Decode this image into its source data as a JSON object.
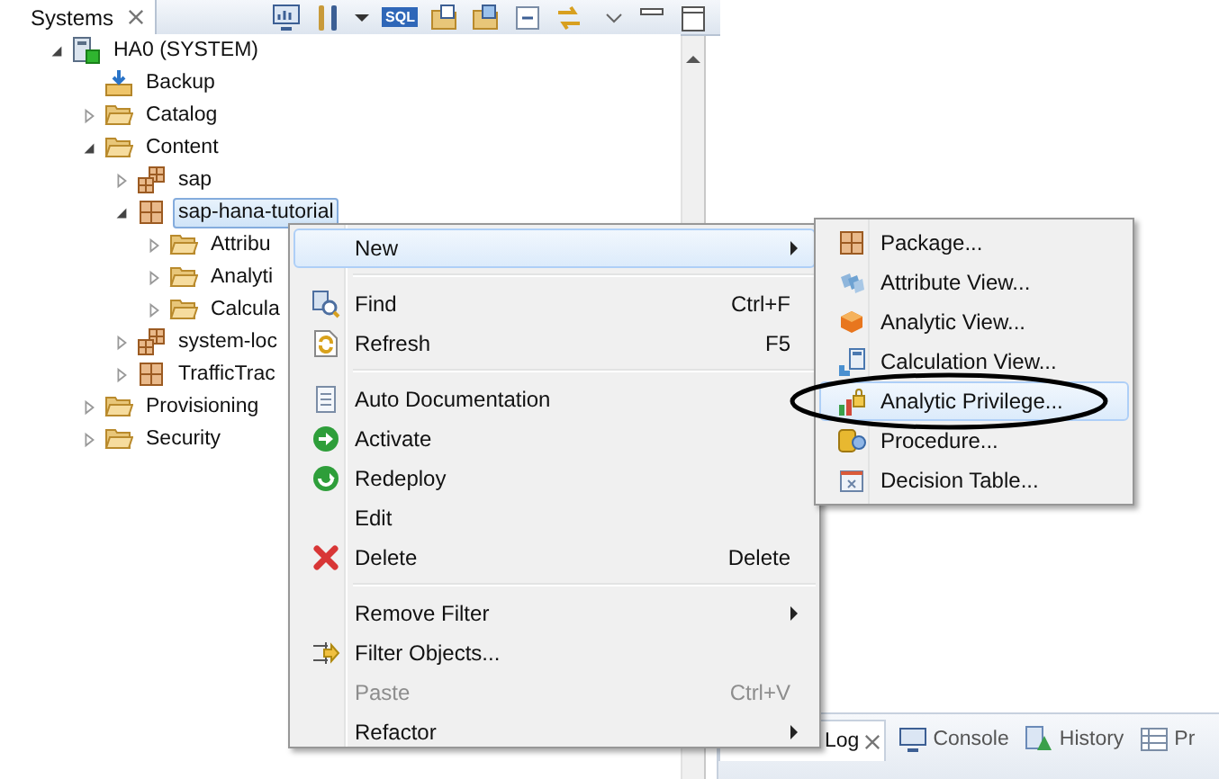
{
  "view_tab": {
    "title": "Systems",
    "selected": true
  },
  "toolbar": {
    "sql_label": "SQL"
  },
  "tree": [
    {
      "label": "HA0 (SYSTEM)",
      "kind": "system",
      "expanded": true,
      "selected": false,
      "children": [
        {
          "label": "Backup",
          "kind": "backup",
          "selected": false
        },
        {
          "label": "Catalog",
          "kind": "folder",
          "expanded": false,
          "selected": false
        },
        {
          "label": "Content",
          "kind": "folder",
          "expanded": true,
          "selected": false,
          "children": [
            {
              "label": "sap",
              "kind": "packages",
              "expanded": false,
              "selected": false
            },
            {
              "label": "sap-hana-tutorial",
              "kind": "package",
              "expanded": true,
              "selected": true,
              "children": [
                {
                  "label": "Attribu",
                  "kind": "folder",
                  "expanded": false,
                  "selected": false
                },
                {
                  "label": "Analyti",
                  "kind": "folder",
                  "expanded": false,
                  "selected": false
                },
                {
                  "label": "Calcula",
                  "kind": "folder",
                  "expanded": false,
                  "selected": false
                }
              ]
            },
            {
              "label": "system-loc",
              "kind": "packages",
              "expanded": false,
              "selected": false
            },
            {
              "label": "TrafficTrac",
              "kind": "package",
              "expanded": false,
              "selected": false
            }
          ]
        },
        {
          "label": "Provisioning",
          "kind": "folder",
          "expanded": false,
          "selected": false
        },
        {
          "label": "Security",
          "kind": "folder",
          "expanded": false,
          "selected": false
        }
      ]
    }
  ],
  "context_menu": {
    "groups": [
      [
        {
          "label": "New",
          "kind": "none",
          "submenu": true,
          "selected": true,
          "disabled": false
        }
      ],
      [
        {
          "label": "Find",
          "kind": "find",
          "shortcut": "Ctrl+F",
          "submenu": false,
          "selected": false,
          "disabled": false
        },
        {
          "label": "Refresh",
          "kind": "refresh",
          "shortcut": "F5",
          "submenu": false,
          "selected": false,
          "disabled": false
        }
      ],
      [
        {
          "label": "Auto Documentation",
          "kind": "document",
          "submenu": false,
          "selected": false,
          "disabled": false
        },
        {
          "label": "Activate",
          "kind": "activate",
          "submenu": false,
          "selected": false,
          "disabled": false
        },
        {
          "label": "Redeploy",
          "kind": "redeploy",
          "submenu": false,
          "selected": false,
          "disabled": false
        },
        {
          "label": "Edit",
          "kind": "none",
          "submenu": false,
          "selected": false,
          "disabled": false
        },
        {
          "label": "Delete",
          "kind": "delete",
          "shortcut": "Delete",
          "submenu": false,
          "selected": false,
          "disabled": false
        }
      ],
      [
        {
          "label": "Remove Filter",
          "kind": "none",
          "submenu": true,
          "selected": false,
          "disabled": false
        },
        {
          "label": "Filter Objects...",
          "kind": "filter",
          "submenu": false,
          "selected": false,
          "disabled": false
        },
        {
          "label": "Paste",
          "kind": "none",
          "shortcut": "Ctrl+V",
          "submenu": false,
          "selected": false,
          "disabled": true
        },
        {
          "label": "Refactor",
          "kind": "none",
          "submenu": true,
          "selected": false,
          "disabled": false
        }
      ]
    ]
  },
  "new_submenu": [
    {
      "label": "Package...",
      "kind": "package",
      "selected": false
    },
    {
      "label": "Attribute View...",
      "kind": "attribute",
      "selected": false
    },
    {
      "label": "Analytic View...",
      "kind": "analytic",
      "selected": false
    },
    {
      "label": "Calculation View...",
      "kind": "calculation",
      "selected": false
    },
    {
      "label": "Analytic Privilege...",
      "kind": "privilege",
      "selected": true,
      "circled": true
    },
    {
      "label": "Procedure...",
      "kind": "procedure",
      "selected": false
    },
    {
      "label": "Decision Table...",
      "kind": "decision",
      "selected": false
    }
  ],
  "bottom_tabs": [
    {
      "label": "Log",
      "kind": "log",
      "selected": true
    },
    {
      "label": "Console",
      "kind": "console",
      "selected": false
    },
    {
      "label": "History",
      "kind": "history",
      "selected": false
    },
    {
      "label": "Pr",
      "kind": "properties",
      "selected": false
    }
  ]
}
